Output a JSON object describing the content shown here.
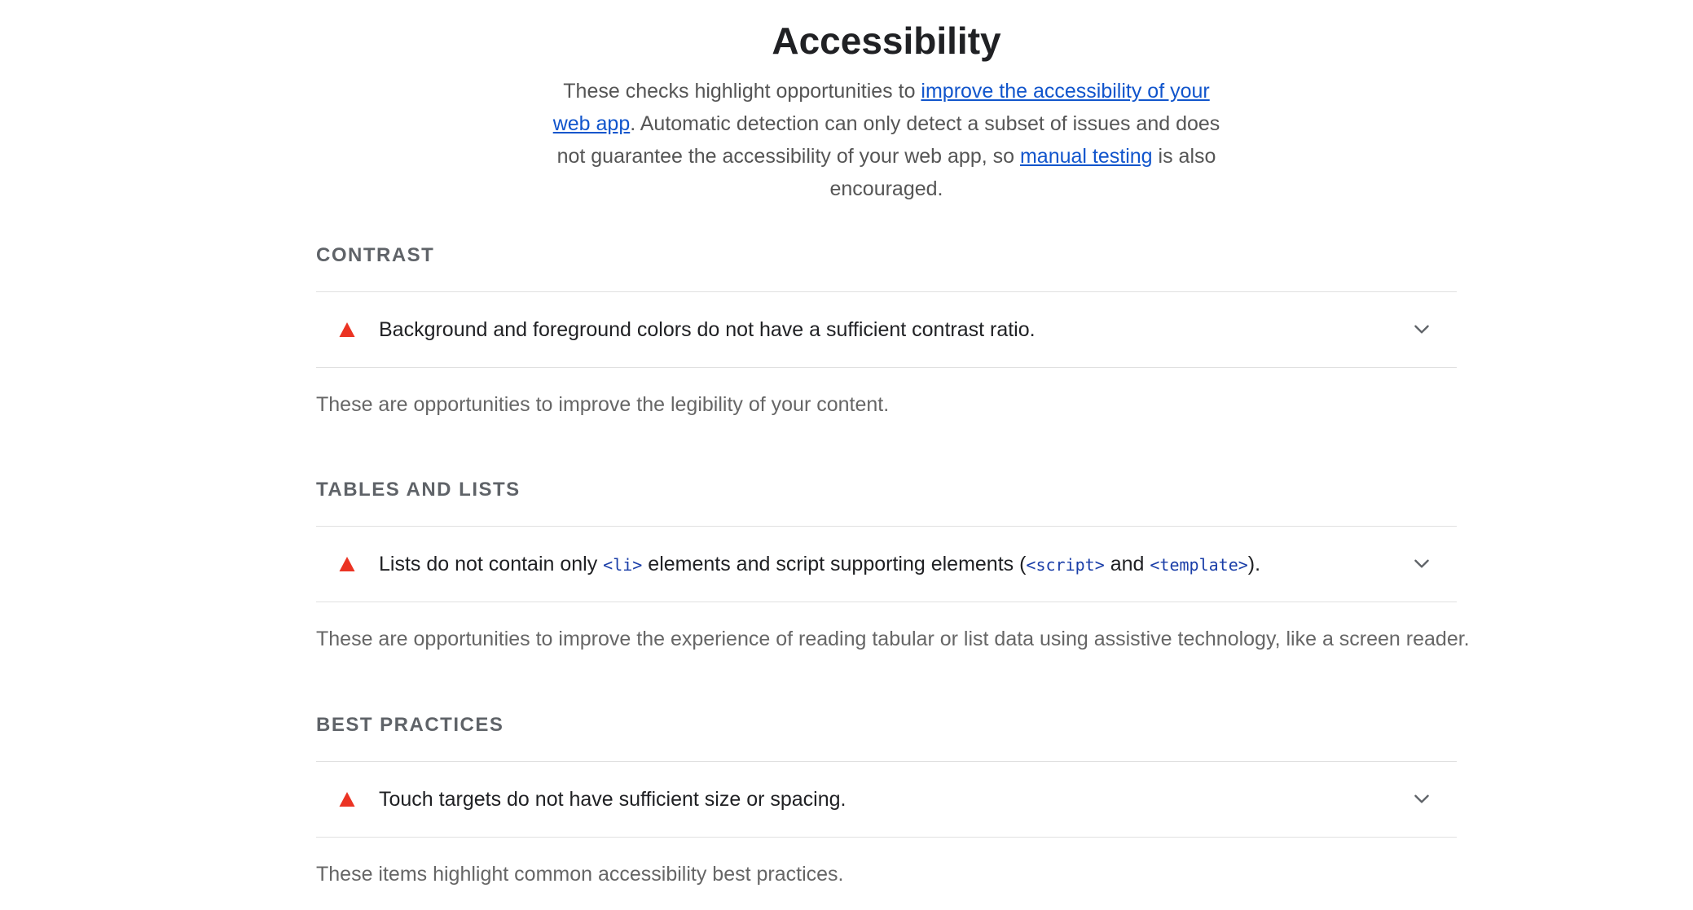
{
  "page": {
    "title": "Accessibility",
    "intro": {
      "text_before_link1": "These checks highlight opportunities to ",
      "link1": "improve the accessibility of your web app",
      "text_after_link1": ". Automatic detection can only detect a subset of issues and does not guarantee the accessibility of your web app, so ",
      "link2": "manual testing",
      "text_end": " is also encouraged."
    }
  },
  "sections": [
    {
      "title": "CONTRAST",
      "audit": {
        "status_icon": "fail-triangle-icon",
        "text": "Background and foreground colors do not have a sufficient contrast ratio."
      },
      "description": "These are opportunities to improve the legibility of your content."
    },
    {
      "title": "TABLES AND LISTS",
      "audit": {
        "status_icon": "fail-triangle-icon",
        "text_part1": "Lists do not contain only ",
        "code1": "<li>",
        "text_part2": " elements and script supporting elements (",
        "code2": "<script>",
        "text_part3": " and ",
        "code3": "<template>",
        "text_part4": ")."
      },
      "description": "These are opportunities to improve the experience of reading tabular or list data using assistive technology, like a screen reader."
    },
    {
      "title": "BEST PRACTICES",
      "audit": {
        "status_icon": "fail-triangle-icon",
        "text": "Touch targets do not have sufficient size or spacing."
      },
      "description": "These items highlight common accessibility best practices."
    }
  ],
  "colors": {
    "fail": "#eb3323",
    "link": "#1155cc",
    "code": "#1a3ea8",
    "heading": "#202124",
    "muted": "#666666"
  }
}
